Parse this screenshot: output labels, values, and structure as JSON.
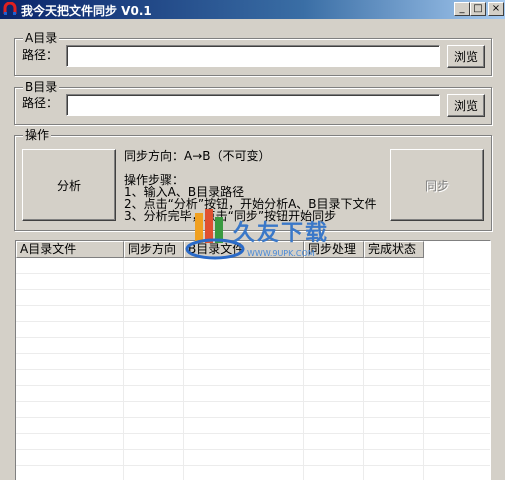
{
  "window": {
    "title": "我今天把文件同步  V0.1",
    "min": "_",
    "max": "□",
    "close": "×"
  },
  "groupA": {
    "legend": "A目录",
    "path_label": "路径：",
    "path_value": "",
    "browse": "浏览"
  },
  "groupB": {
    "legend": "B目录",
    "path_label": "路径：",
    "path_value": "",
    "browse": "浏览"
  },
  "ops": {
    "legend": "操作",
    "analyze": "分析",
    "sync": "同步",
    "direction": "同步方向：A→B（不可变）",
    "steps_title": "操作步骤：",
    "steps": [
      "1、输入A、B目录路径",
      "2、点击“分析”按钮，开始分析A、B目录下文件",
      "3、分析完毕，点击“同步”按钮开始同步"
    ]
  },
  "table": {
    "columns": [
      "A目录文件",
      "同步方向",
      "B目录文件",
      "同步处理",
      "完成状态"
    ],
    "rows": []
  },
  "watermark": {
    "text": "久友下载",
    "url": "WWW.9UPK.COM"
  }
}
